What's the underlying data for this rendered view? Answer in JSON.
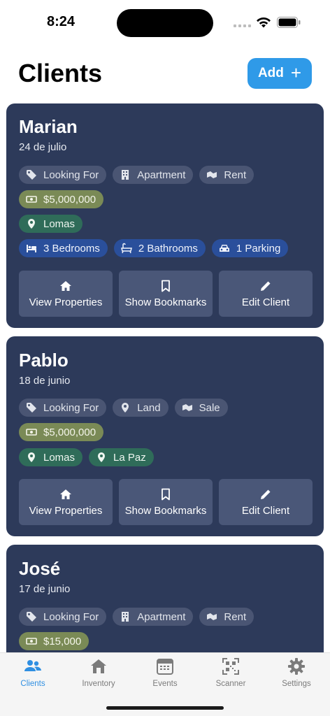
{
  "status_bar": {
    "time": "8:24"
  },
  "header": {
    "title": "Clients",
    "add_label": "Add"
  },
  "colors": {
    "accent": "#2f9ae8",
    "card_bg": "#2d3a5a",
    "chip_gray": "#4a5573",
    "chip_olive": "#7a8a56",
    "chip_green": "#2f6c59",
    "chip_blue": "#2a4f9b"
  },
  "clients": [
    {
      "name": "Marian",
      "date": "24 de julio",
      "tags": [
        "Looking For",
        "Apartment",
        "Rent"
      ],
      "price": "$5,000,000",
      "locations": [
        "Lomas"
      ],
      "features": [
        "3 Bedrooms",
        "2 Bathrooms",
        "1 Parking"
      ]
    },
    {
      "name": "Pablo",
      "date": "18 de junio",
      "tags": [
        "Looking For",
        "Land",
        "Sale"
      ],
      "price": "$5,000,000",
      "locations": [
        "Lomas",
        "La Paz"
      ]
    },
    {
      "name": "José",
      "date": "17 de junio",
      "tags": [
        "Looking For",
        "Apartment",
        "Rent"
      ],
      "price": "$15,000"
    }
  ],
  "card_actions": {
    "view_properties": "View Properties",
    "show_bookmarks": "Show Bookmarks",
    "edit_client": "Edit Client"
  },
  "tab_bar": {
    "items": [
      {
        "label": "Clients",
        "icon": "people-icon",
        "active": true
      },
      {
        "label": "Inventory",
        "icon": "house-icon"
      },
      {
        "label": "Events",
        "icon": "calendar-icon"
      },
      {
        "label": "Scanner",
        "icon": "qr-code-icon"
      },
      {
        "label": "Settings",
        "icon": "gear-icon"
      }
    ]
  }
}
